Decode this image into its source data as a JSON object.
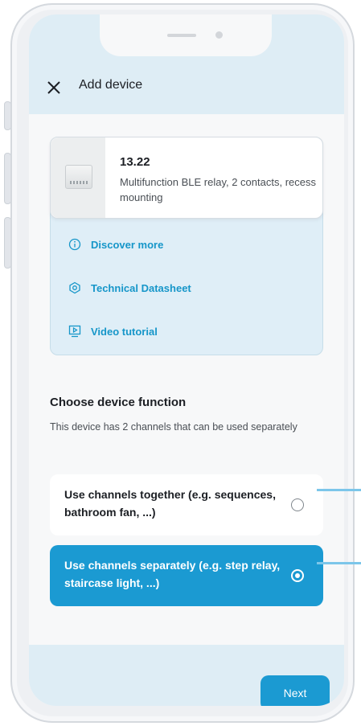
{
  "header": {
    "title": "Add device"
  },
  "product": {
    "code": "13.22",
    "description": "Multifunction BLE relay, 2 contacts, recess mounting",
    "links": [
      {
        "label": "Discover more",
        "icon": "info-icon"
      },
      {
        "label": "Technical Datasheet",
        "icon": "datasheet-icon"
      },
      {
        "label": "Video tutorial",
        "icon": "video-icon"
      }
    ]
  },
  "function_section": {
    "title": "Choose device function",
    "subtitle": "This device has 2 channels that can be used separately",
    "options": [
      {
        "label": "Use channels together (e.g. sequences, bathroom fan, ...)",
        "selected": false
      },
      {
        "label": "Use channels separately (e.g. step relay, staircase light, ...)",
        "selected": true
      }
    ]
  },
  "footer": {
    "next_label": "Next"
  },
  "colors": {
    "accent": "#1b9ad2",
    "header_bg": "#deedf5",
    "link": "#1696c9"
  }
}
